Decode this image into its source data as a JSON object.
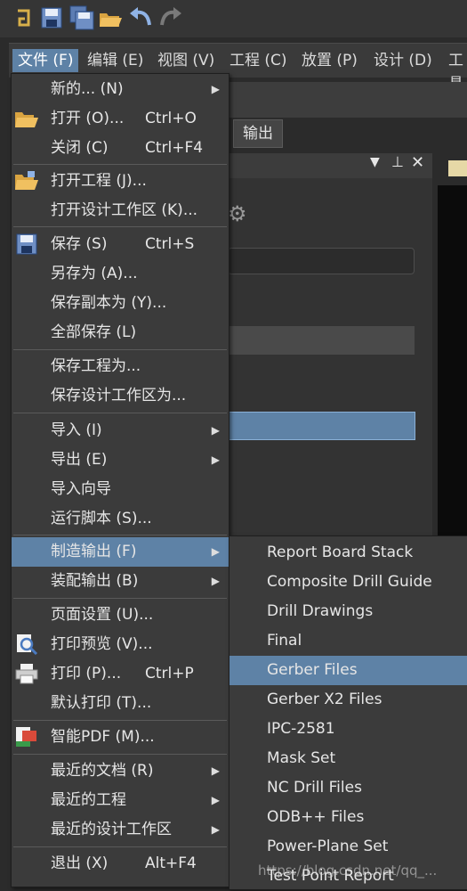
{
  "colors": {
    "accent": "#5e82a6",
    "menu_bg": "#3b3b3b",
    "workspace": "#2b2b2b"
  },
  "toolbar": {
    "icons": [
      "altium-logo-icon",
      "save-icon",
      "save-all-icon",
      "open-folder-icon",
      "undo-icon",
      "redo-icon"
    ]
  },
  "menubar": [
    {
      "label": "文件 (F)"
    },
    {
      "label": "编辑 (E)"
    },
    {
      "label": "视图 (V)"
    },
    {
      "label": "工程 (C)"
    },
    {
      "label": "放置 (P)"
    },
    {
      "label": "设计 (D)"
    },
    {
      "label": "工具"
    }
  ],
  "background": {
    "output_tab": "输出"
  },
  "file_menu": [
    {
      "label": "新的... (N)",
      "shortcut": ""
    },
    {
      "label": "打开 (O)...",
      "shortcut": "Ctrl+O"
    },
    {
      "label": "关闭 (C)",
      "shortcut": "Ctrl+F4"
    },
    {
      "label": "打开工程 (J)...",
      "shortcut": ""
    },
    {
      "label": "打开设计工作区 (K)...",
      "shortcut": ""
    },
    {
      "label": "保存 (S)",
      "shortcut": "Ctrl+S"
    },
    {
      "label": "另存为 (A)...",
      "shortcut": ""
    },
    {
      "label": "保存副本为 (Y)...",
      "shortcut": ""
    },
    {
      "label": "全部保存 (L)",
      "shortcut": ""
    },
    {
      "label": "保存工程为...",
      "shortcut": ""
    },
    {
      "label": "保存设计工作区为...",
      "shortcut": ""
    },
    {
      "label": "导入 (I)",
      "shortcut": ""
    },
    {
      "label": "导出 (E)",
      "shortcut": ""
    },
    {
      "label": "导入向导",
      "shortcut": ""
    },
    {
      "label": "运行脚本 (S)...",
      "shortcut": ""
    },
    {
      "label": "制造输出 (F)",
      "shortcut": ""
    },
    {
      "label": "装配输出 (B)",
      "shortcut": ""
    },
    {
      "label": "页面设置 (U)...",
      "shortcut": ""
    },
    {
      "label": "打印预览 (V)...",
      "shortcut": ""
    },
    {
      "label": "打印 (P)...",
      "shortcut": "Ctrl+P"
    },
    {
      "label": "默认打印 (T)...",
      "shortcut": ""
    },
    {
      "label": "智能PDF (M)...",
      "shortcut": ""
    },
    {
      "label": "最近的文档 (R)",
      "shortcut": ""
    },
    {
      "label": "最近的工程",
      "shortcut": ""
    },
    {
      "label": "最近的设计工作区",
      "shortcut": ""
    },
    {
      "label": "退出 (X)",
      "shortcut": "Alt+F4"
    }
  ],
  "fab_submenu": [
    {
      "label": "Report Board Stack"
    },
    {
      "label": "Composite Drill Guide"
    },
    {
      "label": "Drill Drawings"
    },
    {
      "label": "Final"
    },
    {
      "label": "Gerber Files"
    },
    {
      "label": "Gerber X2 Files"
    },
    {
      "label": "IPC-2581"
    },
    {
      "label": "Mask Set"
    },
    {
      "label": "NC Drill Files"
    },
    {
      "label": "ODB++ Files"
    },
    {
      "label": "Power-Plane Set"
    },
    {
      "label": "Test Point Report"
    }
  ],
  "watermark": "https://blog.csdn.net/qq_..."
}
